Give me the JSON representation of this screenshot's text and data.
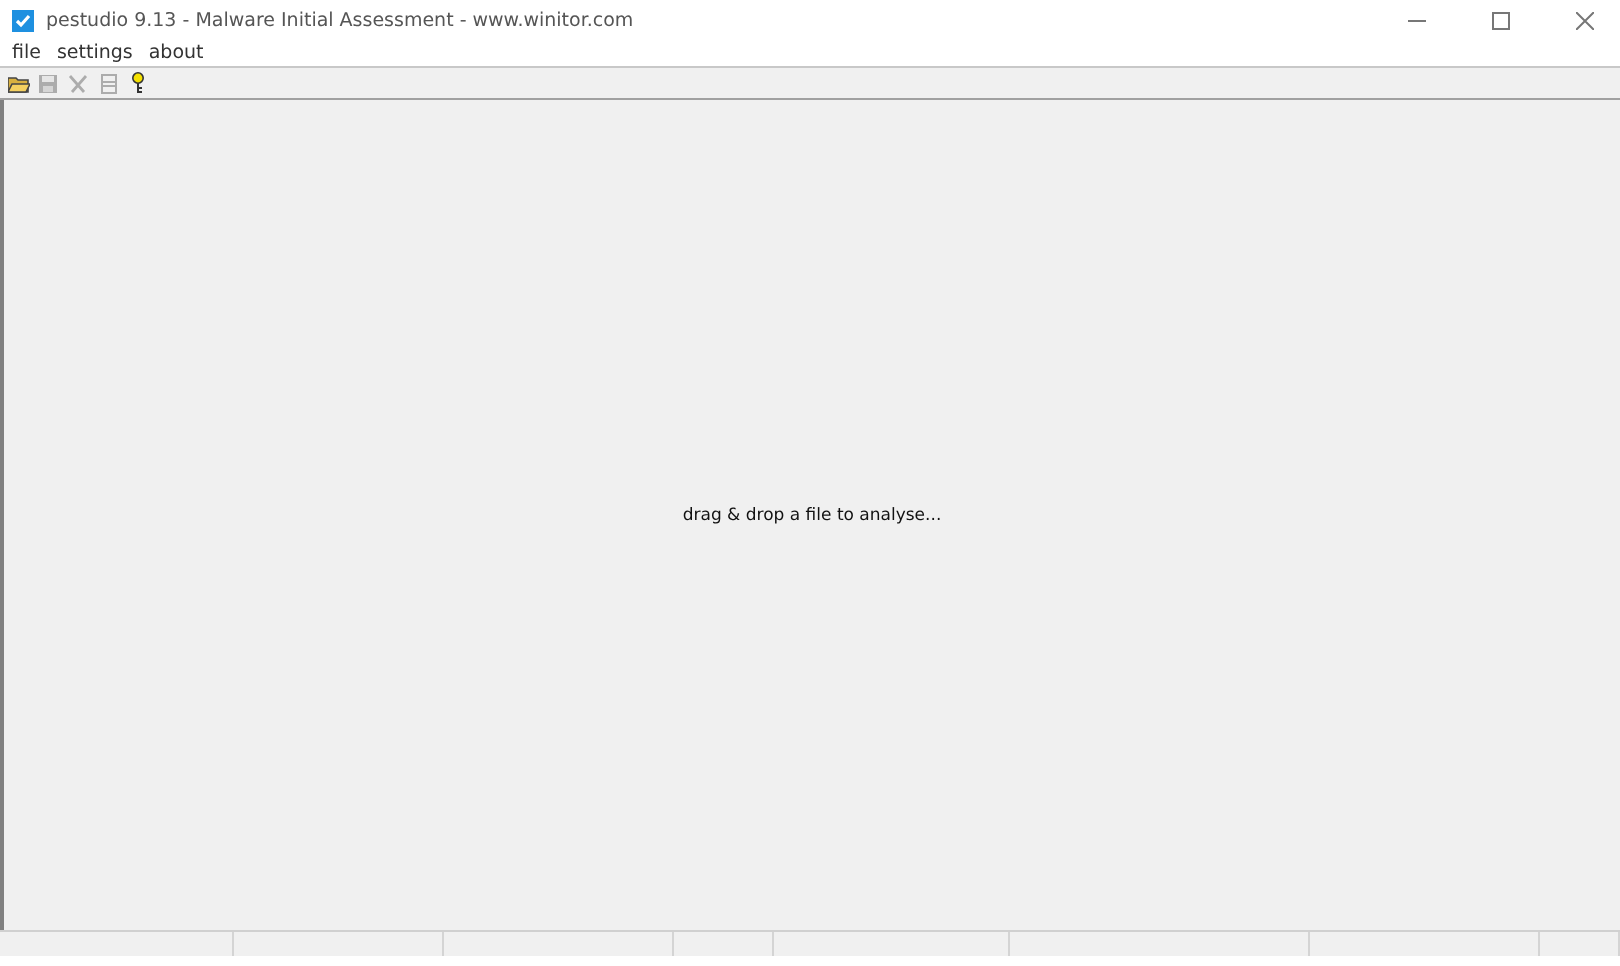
{
  "window": {
    "title": "pestudio 9.13 - Malware Initial Assessment - www.winitor.com"
  },
  "menu": [
    "file",
    "settings",
    "about"
  ],
  "toolbar": [
    {
      "kind": "open",
      "disabled": false
    },
    {
      "kind": "save",
      "disabled": true
    },
    {
      "kind": "cut",
      "disabled": true
    },
    {
      "kind": "print",
      "disabled": true
    },
    {
      "kind": "help",
      "disabled": false
    }
  ],
  "main": {
    "hint": "drag & drop a file to analyse..."
  }
}
